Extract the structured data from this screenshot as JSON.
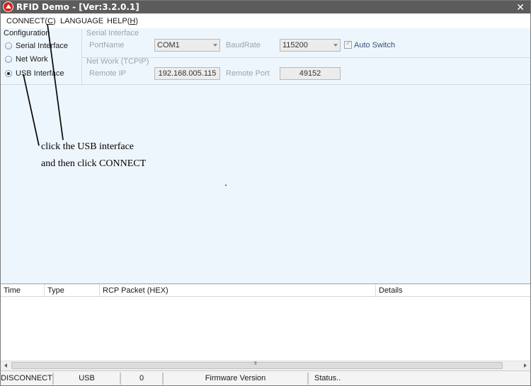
{
  "window": {
    "title": "RFID Demo - [Ver:3.2.0.1]",
    "close_glyph": "✕"
  },
  "menu": {
    "connect_prefix": "CONNECT(",
    "connect_key": "C",
    "connect_suffix": ")",
    "language": "LANGUAGE",
    "help_prefix": "HELP(",
    "help_key": "H",
    "help_suffix": ")"
  },
  "configuration": {
    "label": "Configuration",
    "options": [
      {
        "label": "Serial Interface",
        "checked": false
      },
      {
        "label": "Net Work",
        "checked": false
      },
      {
        "label": "USB Interface",
        "checked": true
      }
    ]
  },
  "serial": {
    "group_title": "Serial Interface",
    "port_label": "PortName",
    "port_value": "COM1",
    "baud_label": "BaudRate",
    "baud_value": "115200",
    "auto_switch_label": "Auto Switch",
    "auto_switch_checked": true
  },
  "network": {
    "group_title": "Net Work (TCPIP)",
    "ip_label": "Remote IP",
    "ip_value": "192.168.005.115",
    "port_label": "Remote Port",
    "port_value": "49152"
  },
  "annotation": {
    "line1": "click the USB interface",
    "line2": "and then click CONNECT"
  },
  "log_table": {
    "columns": [
      "Time",
      "Type",
      "RCP Packet (HEX)",
      "Details"
    ],
    "rows": []
  },
  "statusbar": {
    "connection": "DISCONNECT",
    "interface": "USB",
    "count": "0",
    "firmware": "Firmware Version",
    "status": "Status.."
  },
  "colors": {
    "titlebar": "#5c5c5c",
    "panel_background": "#eef6fd",
    "app_icon": "#d4241f"
  }
}
